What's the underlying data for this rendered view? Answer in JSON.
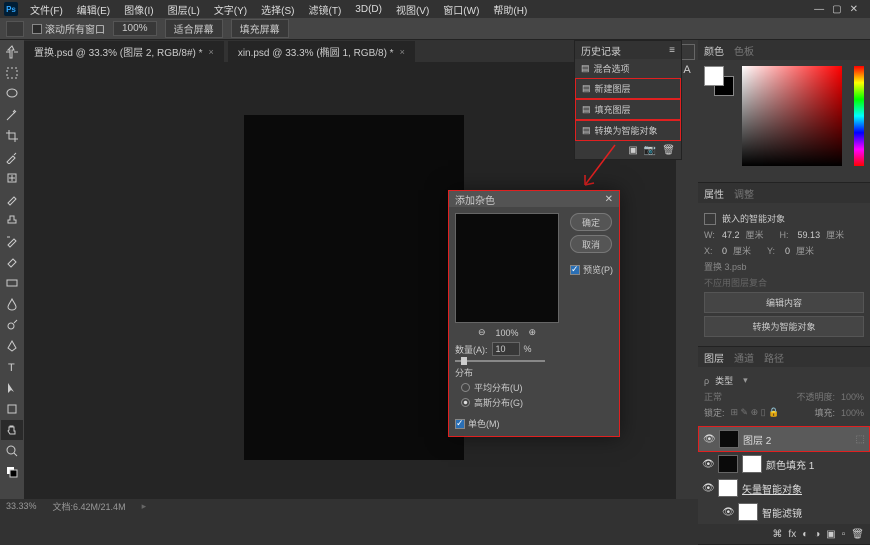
{
  "app": {
    "logo": "Ps"
  },
  "menu": {
    "file": "文件(F)",
    "edit": "编辑(E)",
    "image": "图像(I)",
    "layer": "图层(L)",
    "type": "文字(Y)",
    "select": "选择(S)",
    "filter": "滤镜(T)",
    "threed": "3D(D)",
    "view": "视图(V)",
    "window": "窗口(W)",
    "help": "帮助(H)"
  },
  "options": {
    "scroll_all": "滚动所有窗口",
    "zoom_100": "100%",
    "fit_screen": "适合屏幕",
    "fill_screen": "填充屏幕"
  },
  "tabs": {
    "t1": "置换.psd @ 33.3% (图层 2, RGB/8#) *",
    "t2": "xin.psd @ 33.3% (椭圆 1, RGB/8) *"
  },
  "history": {
    "title": "历史记录",
    "i1": "混合选项",
    "i2": "新建图层",
    "i3": "填充图层",
    "i4": "转换为智能对象"
  },
  "dialog": {
    "title": "添加杂色",
    "ok": "确定",
    "cancel": "取消",
    "preview": "预览(P)",
    "zoom": "100%",
    "amount_label": "数量(A):",
    "amount_value": "10",
    "amount_unit": "%",
    "distribution": "分布",
    "uniform": "平均分布(U)",
    "gaussian": "高斯分布(G)",
    "monochromatic": "单色(M)"
  },
  "panels": {
    "color": "颜色",
    "swatches": "色板",
    "properties": "属性",
    "adjustments": "调整",
    "layers": "图层",
    "channels": "通道",
    "paths": "路径"
  },
  "props": {
    "smart_object": "嵌入的智能对象",
    "w_label": "W:",
    "w_val": "47.2",
    "w_unit": "厘米",
    "h_label": "H:",
    "h_val": "59.13",
    "h_unit": "厘米",
    "x_label": "X:",
    "x_val": "0",
    "x_unit": "厘米",
    "y_label": "Y:",
    "y_val": "0",
    "y_unit": "厘米",
    "file": "置换 3.psb",
    "no_filter": "不应用图层复合",
    "edit_content": "编辑内容",
    "convert": "转换为智能对象"
  },
  "layers_panel": {
    "kind": "类型",
    "normal": "正常",
    "opacity_label": "不透明度:",
    "opacity": "100%",
    "lock_label": "锁定:",
    "fill_label": "填充:",
    "fill": "100%",
    "layer2": "图层 2",
    "color_fill": "颜色填充 1",
    "vector_smart": "矢量智能对象",
    "smart_filter": "智能滤镜"
  },
  "status": {
    "zoom": "33.33%",
    "doc": "文档:6.42M/21.4M"
  }
}
